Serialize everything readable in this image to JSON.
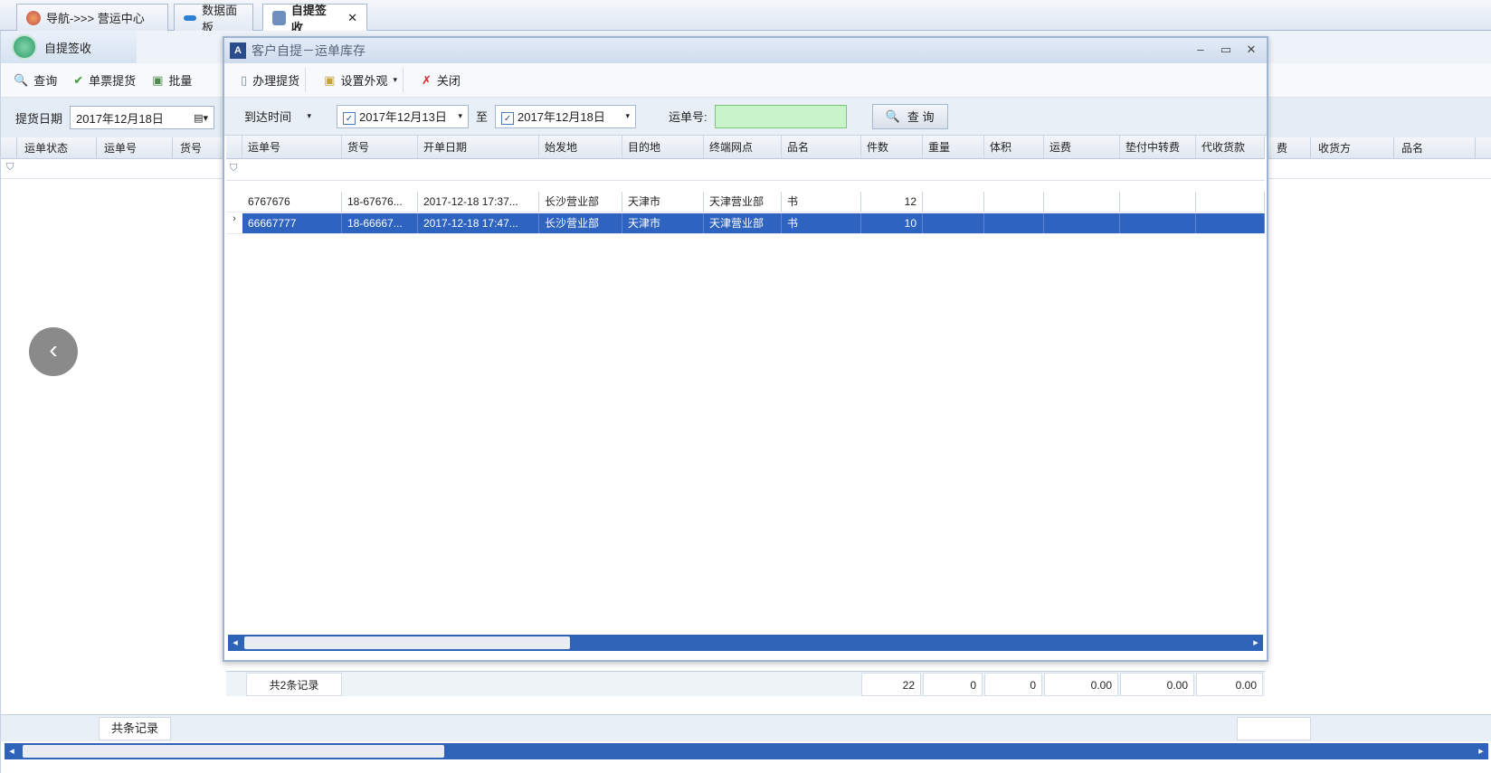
{
  "tabs": [
    {
      "label": "导航->>> 营运中心",
      "icon": "globe-icon"
    },
    {
      "label": "数据面板",
      "icon": "panel-icon"
    },
    {
      "label": "自提签收",
      "icon": "document-icon",
      "active": true,
      "close": "✕"
    }
  ],
  "page": {
    "title": "自提签收",
    "toolbar": [
      "查询",
      "单票提货",
      "批量"
    ],
    "filter_label": "提货日期",
    "filter_date": "2017年12月18日",
    "columns": [
      "运单状态",
      "运单号",
      "货号"
    ],
    "right_columns": [
      "费",
      "收货方",
      "品名"
    ],
    "footer_count": "共条记录"
  },
  "dialog": {
    "title": "客户自提－运单库存",
    "toolbar": {
      "handle": "办理提货",
      "appearance": "设置外观",
      "close": "关闭"
    },
    "filter": {
      "time_type": "到达时间",
      "date_from": "2017年12月13日",
      "to_label": "至",
      "date_to": "2017年12月18日",
      "waybill_label": "运单号:",
      "waybill_value": "",
      "search_label": "查 询"
    },
    "grid": {
      "columns": [
        "运单号",
        "货号",
        "开单日期",
        "始发地",
        "目的地",
        "终端网点",
        "品名",
        "件数",
        "重量",
        "体积",
        "运费",
        "垫付中转费",
        "代收货款"
      ],
      "rows": [
        [
          "6767676",
          "18-67676...",
          "2017-12-18 17:37...",
          "长沙营业部",
          "天津市",
          "天津营业部",
          "书",
          "12",
          "",
          "",
          "",
          "",
          ""
        ],
        [
          "66667777",
          "18-66667...",
          "2017-12-18 17:47...",
          "长沙营业部",
          "天津市",
          "天津营业部",
          "书",
          "10",
          "",
          "",
          "",
          "",
          ""
        ]
      ],
      "selected_row": 1,
      "footer": {
        "count": "共2条记录",
        "pieces": "22",
        "weight": "0",
        "volume": "0",
        "freight": "0.00",
        "transfer": "0.00",
        "cod": "0.00"
      }
    }
  },
  "colors": {
    "selection": "#2f63c0",
    "accent": "#2f63b8",
    "waybill_input": "#c9f3c9"
  }
}
